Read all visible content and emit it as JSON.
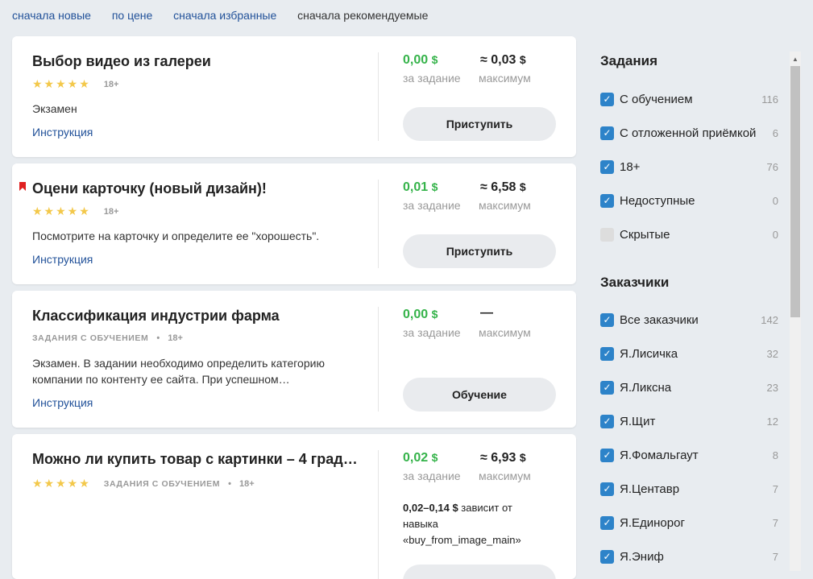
{
  "sort": {
    "newest": "сначала новые",
    "price": "по цене",
    "favorites": "сначала избранные",
    "recommended": "сначала рекомендуемые"
  },
  "cards": [
    {
      "title": "Выбор видео из галереи",
      "stars": "★★★★★",
      "age": "18+",
      "desc": "Экзамен",
      "instruction": "Инструкция",
      "price": "0,00",
      "price_currency": "$",
      "price_label": "за задание",
      "max": "≈ 0,03",
      "max_currency": "$",
      "max_label": "максимум",
      "button": "Приступить"
    },
    {
      "title": "Оцени карточку (новый дизайн)!",
      "stars": "★★★★★",
      "age": "18+",
      "desc": "Посмотрите на карточку и определите ее \"хорошесть\".",
      "instruction": "Инструкция",
      "price": "0,01",
      "price_currency": "$",
      "price_label": "за задание",
      "max": "≈ 6,58",
      "max_currency": "$",
      "max_label": "максимум",
      "button": "Приступить"
    },
    {
      "title": "Классификация индустрии фарма",
      "tag": "ЗАДАНИЯ С ОБУЧЕНИЕМ",
      "dot": "•",
      "age": "18+",
      "desc": "Экзамен. В задании необходимо определить категорию компании по контенту ее сайта. При успешном…",
      "instruction": "Инструкция",
      "price": "0,00",
      "price_currency": "$",
      "price_label": "за задание",
      "max": "—",
      "max_label": "максимум",
      "button": "Обучение"
    },
    {
      "title": "Можно ли купить товар с картинки – 4 града…",
      "stars": "★★★★★",
      "tag": "ЗАДАНИЯ С ОБУЧЕНИЕМ",
      "dot": "•",
      "age": "18+",
      "price": "0,02",
      "price_currency": "$",
      "price_label": "за задание",
      "max": "≈ 6,93",
      "max_currency": "$",
      "max_label": "максимум",
      "note_range": "0,02–0,14 $",
      "note_text": " зависит от навыка «buy_from_image_main»"
    }
  ],
  "sidebar": {
    "tasks_title": "Задания",
    "tasks": [
      {
        "label": "С обучением",
        "count": "116",
        "checked": true
      },
      {
        "label": "С отложенной приёмкой",
        "count": "6",
        "checked": true
      },
      {
        "label": "18+",
        "count": "76",
        "checked": true
      },
      {
        "label": "Недоступные",
        "count": "0",
        "checked": true
      },
      {
        "label": "Скрытые",
        "count": "0",
        "checked": false
      }
    ],
    "customers_title": "Заказчики",
    "customers": [
      {
        "label": "Все заказчики",
        "count": "142",
        "checked": true
      },
      {
        "label": "Я.Лисичка",
        "count": "32",
        "checked": true
      },
      {
        "label": "Я.Ликсна",
        "count": "23",
        "checked": true
      },
      {
        "label": "Я.Щит",
        "count": "12",
        "checked": true
      },
      {
        "label": "Я.Фомальгаут",
        "count": "8",
        "checked": true
      },
      {
        "label": "Я.Центавр",
        "count": "7",
        "checked": true
      },
      {
        "label": "Я.Единорог",
        "count": "7",
        "checked": true
      },
      {
        "label": "Я.Эниф",
        "count": "7",
        "checked": true
      }
    ]
  },
  "colors": {
    "link": "#215199",
    "price": "#35b34a",
    "checkbox": "#2d83c9",
    "star": "#f3c84a",
    "bookmark": "#e02020"
  },
  "icons": {
    "checkbox_checked": "check-icon",
    "bookmark": "bookmark-icon",
    "scroll_up": "triangle-up-icon"
  }
}
